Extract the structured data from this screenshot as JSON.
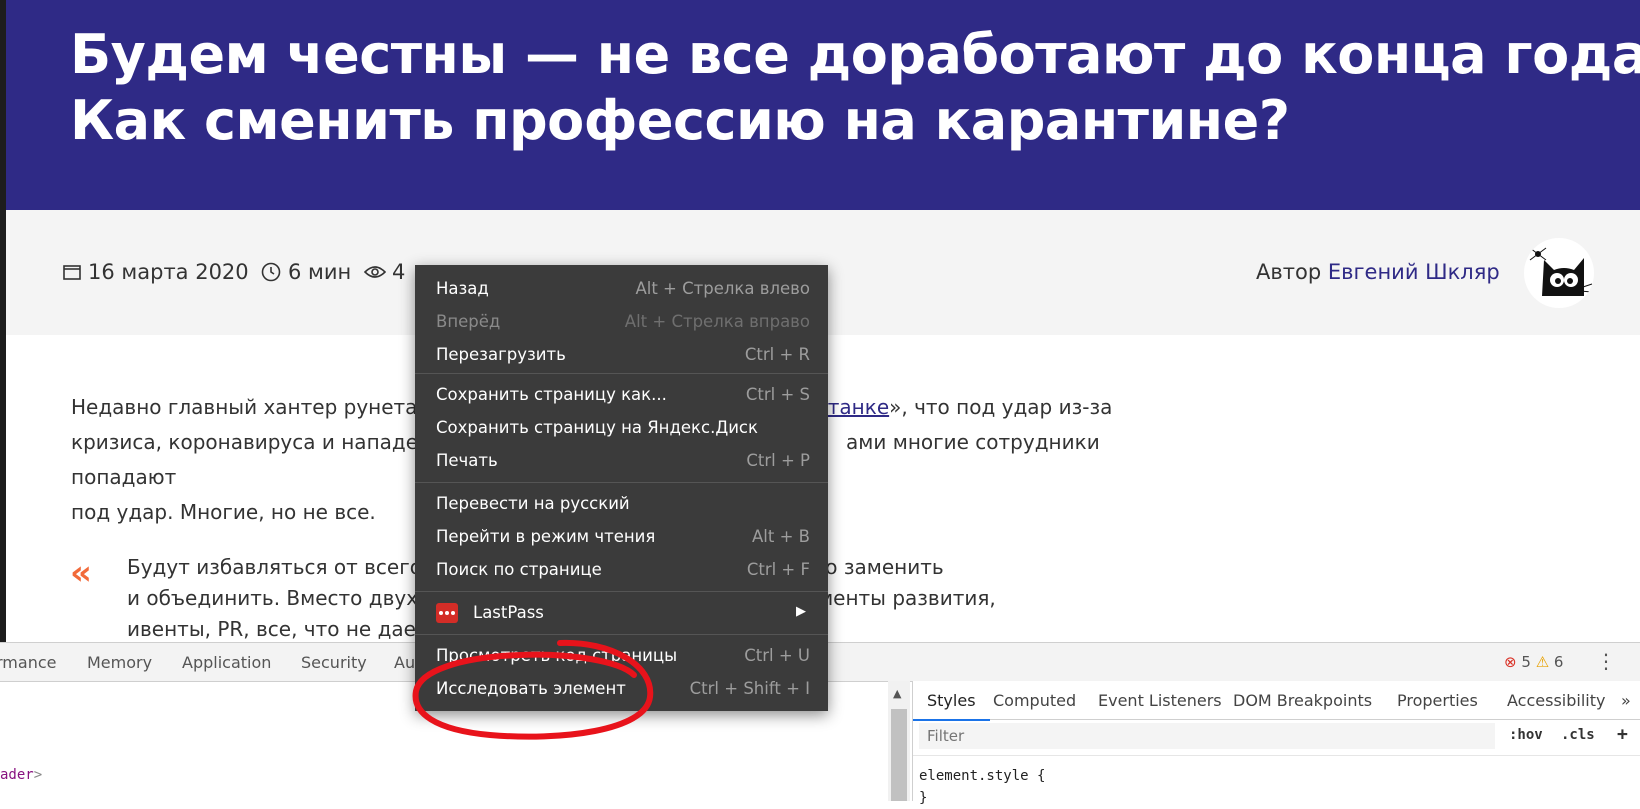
{
  "article": {
    "title_line1": "Будем честны — не все доработают до конца года.",
    "title_line2": "Как сменить профессию на карантине?",
    "date": "16 марта 2020",
    "read_time": "6 мин",
    "views_partial": "4",
    "author_label": "Автор",
    "author_name": "Евгений Шкляр",
    "para_line1_a": "Недавно главный хантер рунета",
    "para_line1_link": "онтанке",
    "para_line1_b": "», что под удар из-за",
    "para_line2_a": "кризиса, коронавируса и нападе",
    "para_line2_b": "ами многие сотрудники попадают",
    "para_line3": "под удар. Многие, но не все.",
    "quote_mark": "«",
    "quote_line1_a": "Будут избавляться от всего",
    "quote_line1_b": "ожно заменить",
    "quote_line2_a": "и объединить. Вместо двух",
    "quote_line2_b": "менты развития,",
    "quote_line3_a": "ивенты, PR, все, что не дае"
  },
  "context_menu": {
    "items": [
      {
        "label": "Назад",
        "shortcut": "Alt + Стрелка влево",
        "enabled": true
      },
      {
        "label": "Вперёд",
        "shortcut": "Alt + Стрелка вправо",
        "enabled": false
      },
      {
        "label": "Перезагрузить",
        "shortcut": "Ctrl + R",
        "enabled": true
      },
      {
        "label": "Сохранить страницу как...",
        "shortcut": "Ctrl + S",
        "enabled": true
      },
      {
        "label": "Сохранить страницу на Яндекс.Диск",
        "shortcut": "",
        "enabled": true
      },
      {
        "label": "Печать",
        "shortcut": "Ctrl + P",
        "enabled": true
      },
      {
        "label": "Перевести на русский",
        "shortcut": "",
        "enabled": true
      },
      {
        "label": "Перейти в режим чтения",
        "shortcut": "Alt + B",
        "enabled": true
      },
      {
        "label": "Поиск по странице",
        "shortcut": "Ctrl + F",
        "enabled": true
      },
      {
        "label": "LastPass",
        "shortcut": "",
        "enabled": true
      },
      {
        "label": "Просмотреть код страницы",
        "shortcut": "Ctrl + U",
        "enabled": true
      },
      {
        "label": "Исследовать элемент",
        "shortcut": "Ctrl + Shift + I",
        "enabled": true
      }
    ]
  },
  "devtools": {
    "tabs": [
      "rmance",
      "Memory",
      "Application",
      "Security",
      "Au"
    ],
    "error_count": "5",
    "warning_count": "6",
    "code_line": "ader",
    "styles_tabs": [
      "Styles",
      "Computed",
      "Event Listeners",
      "DOM Breakpoints",
      "Properties",
      "Accessibility"
    ],
    "more_tabs": "»",
    "filter_placeholder": "Filter",
    "hov": ":hov",
    "cls": ".cls",
    "add": "+",
    "element_style_open": "element.style {",
    "element_style_close": "}"
  },
  "colors": {
    "hero_bg": "#2f2a86",
    "accent_orange": "#f26a3a",
    "menu_bg": "#3b3b3b",
    "highlight_red": "#e8131b",
    "lastpass_red": "#d32d27"
  }
}
